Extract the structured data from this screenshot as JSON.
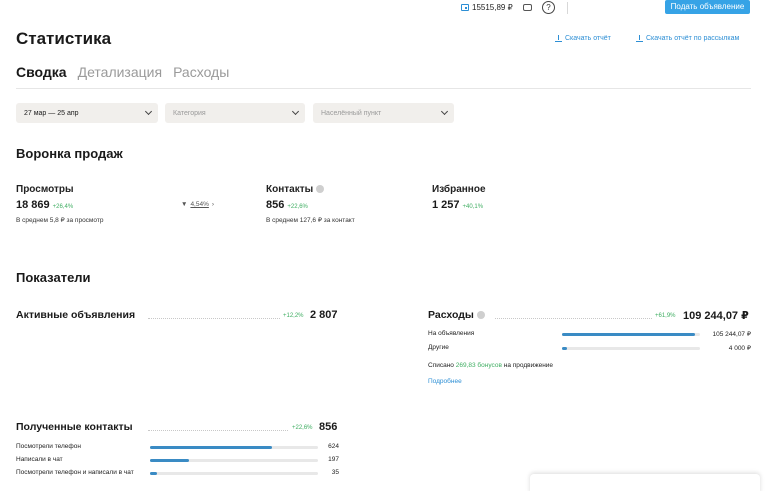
{
  "header": {
    "wallet_balance": "15515,89 ₽",
    "post_ad_label": "Подать объявление"
  },
  "page": {
    "title": "Статистика",
    "download_report": "Скачать отчёт",
    "download_report_mailing": "Скачать отчёт по рассылкам"
  },
  "tabs": [
    {
      "label": "Сводка",
      "active": true
    },
    {
      "label": "Детализация",
      "active": false
    },
    {
      "label": "Расходы",
      "active": false
    }
  ],
  "filters": {
    "period": "27 мар — 25 апр",
    "category_placeholder": "Категория",
    "location_placeholder": "Населённый пункт"
  },
  "funnel": {
    "title": "Воронка продаж",
    "views": {
      "label": "Просмотры",
      "value": "18 869",
      "delta": "+26,4%",
      "note": "В среднем 5,8 ₽ за просмотр"
    },
    "conversion": "4,54%",
    "contacts": {
      "label": "Контакты",
      "value": "856",
      "delta": "+22,6%",
      "note": "В среднем 127,6 ₽ за контакт"
    },
    "favorites": {
      "label": "Избранное",
      "value": "1 257",
      "delta": "+40,1%"
    }
  },
  "indicators": {
    "title": "Показатели",
    "active_ads": {
      "label": "Активные объявления",
      "delta": "+12,2%",
      "total": "2 807"
    },
    "expenses": {
      "label": "Расходы",
      "delta": "+61,9%",
      "total": "109 244,07 ₽",
      "rows": [
        {
          "label": "На объявления",
          "value": "105 244,07 ₽",
          "share": 0.963
        },
        {
          "label": "Другие",
          "value": "4 000 ₽",
          "share": 0.037
        }
      ],
      "spent_prefix": "Списано",
      "spent_bonus": "269,83 бонусов",
      "spent_suffix": "на продвижение",
      "more_link": "Подробнее"
    },
    "contacts_received": {
      "label": "Полученные контакты",
      "delta": "+22,6%",
      "total": "856",
      "rows": [
        {
          "label": "Посмотрели телефон",
          "value": "624",
          "share": 0.729
        },
        {
          "label": "Написали в чат",
          "value": "197",
          "share": 0.23
        },
        {
          "label": "Посмотрели телефон и написали в чат",
          "value": "35",
          "share": 0.041
        }
      ]
    }
  },
  "colors": {
    "accent": "#36a3e6",
    "link": "#2d8fd5",
    "positive": "#3fae62",
    "bar": "#3a8bc4"
  }
}
